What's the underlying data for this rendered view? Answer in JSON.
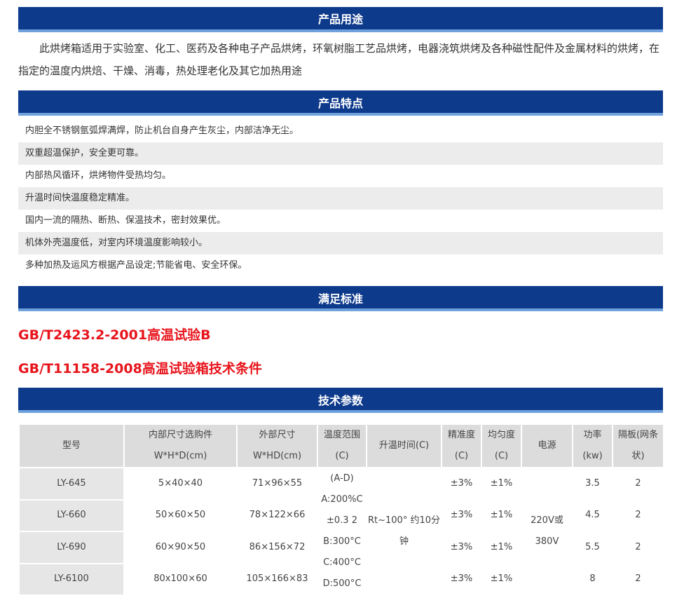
{
  "sections": {
    "usage_title": "产品用途",
    "features_title": "产品特点",
    "standards_title": "满足标准",
    "specs_title": "技术参数"
  },
  "usage": {
    "text": "此烘烤箱适用于实验室、化工、医药及各种电子产品烘烤，环氧树脂工艺品烘烤，电器浇筑烘烤及各种磁性配件及金属材料的烘烤，在指定的温度内烘焙、干燥、消毒，热处理老化及其它加热用途"
  },
  "features": [
    "内胆全不锈钢氩弧焊满焊，防止机台自身产生灰尘，内部洁净无尘。",
    "双重超温保护，安全更可靠。",
    "内部热风循环，烘烤物件受热均匀。",
    "升温时间快温度稳定精准。",
    "国内一流的隔热、断热、保温技术，密封效果优。",
    "机体外壳温度低，对室内环境温度影响较小。",
    "多种加热及运风方根据产品设定;节能省电、安全环保。"
  ],
  "standards": [
    "GB/T2423.2-2001高温试验B",
    "GB/T11158-2008高温试验箱技术条件"
  ],
  "table": {
    "headers": {
      "model": "型号",
      "inner_size_1": "内部尺寸选购件",
      "inner_size_2": "W*H*D(cm)",
      "outer_size_1": "外部尺寸",
      "outer_size_2": "W*HD(cm)",
      "temp_range_1": "温度范围",
      "temp_range_2": "(C)",
      "heat_time": "升温时间(C)",
      "accuracy_1": "精准度",
      "accuracy_2": "(C)",
      "uniformity_1": "均匀度",
      "uniformity_2": "(C)",
      "power_supply": "电源",
      "power_1": "功率",
      "power_2": "(kw)",
      "shelf_1": "隔板(网条",
      "shelf_2": "状)"
    },
    "rows": [
      {
        "model": "LY-645",
        "inner": "5×40×40",
        "outer": "71×96×55",
        "accuracy": "±3%",
        "uniformity": "±1%",
        "power": "3.5",
        "shelf": "2"
      },
      {
        "model": "LY-660",
        "inner": "50×60×50",
        "outer": "78×122×66",
        "accuracy": "±3%",
        "uniformity": "±1%",
        "power": "4.5",
        "shelf": "2"
      },
      {
        "model": "LY-690",
        "inner": "60×90×50",
        "outer": "86×156×72",
        "accuracy": "±3%",
        "uniformity": "±1%",
        "power": "5.5",
        "shelf": "2"
      },
      {
        "model": "LY-6100",
        "inner": "80x100×60",
        "outer": "105×166×83",
        "accuracy": "±3%",
        "uniformity": "±1%",
        "power": "8",
        "shelf": "2"
      }
    ],
    "temp_range_lines": [
      "(A-D)",
      "A:200%C",
      "±0.3 2",
      "B:300°C",
      "C:400°C",
      "D:500°C"
    ],
    "heat_time_lines": [
      "Rt~100° 约10分",
      "钟"
    ],
    "power_supply_lines": [
      "220V或",
      "380V"
    ]
  }
}
